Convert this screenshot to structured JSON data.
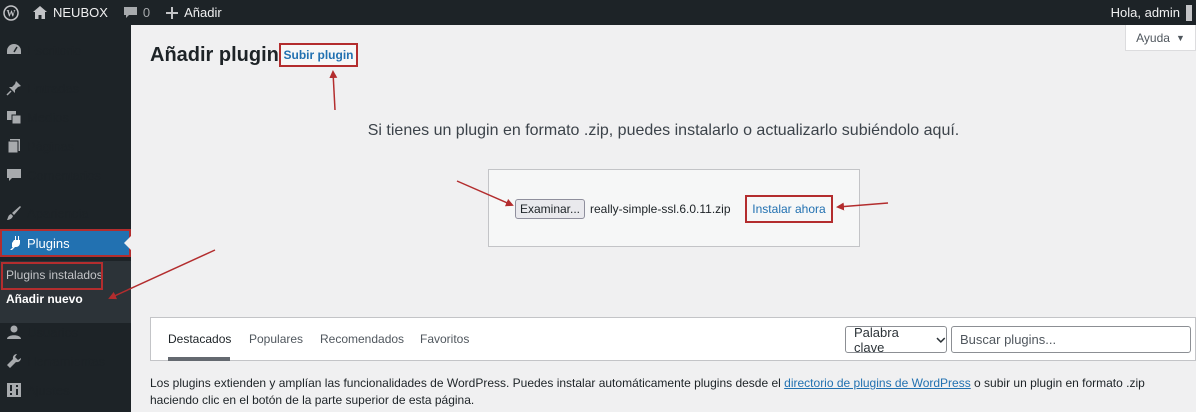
{
  "admin_bar": {
    "site_name": "NEUBOX",
    "comments_count": "0",
    "new_label": "Añadir",
    "greeting": "Hola, admin"
  },
  "sidebar": {
    "items": [
      {
        "label": "Escritorio",
        "icon": "dashboard-icon"
      },
      {
        "label": "Entradas",
        "icon": "pin-icon"
      },
      {
        "label": "Medios",
        "icon": "media-icon"
      },
      {
        "label": "Páginas",
        "icon": "pages-icon"
      },
      {
        "label": "Comentarios",
        "icon": "comments-icon"
      },
      {
        "label": "Apariencia",
        "icon": "appearance-icon"
      },
      {
        "label": "Plugins",
        "icon": "plugins-icon",
        "active": true
      },
      {
        "label": "Usuarios",
        "icon": "users-icon"
      },
      {
        "label": "Herramientas",
        "icon": "tools-icon"
      },
      {
        "label": "Ajustes",
        "icon": "settings-icon"
      }
    ],
    "submenu": [
      {
        "label": "Plugins instalados"
      },
      {
        "label": "Añadir nuevo",
        "current": true
      }
    ]
  },
  "header": {
    "title": "Añadir plugins",
    "upload_label": "Subir plugin",
    "help_label": "Ayuda"
  },
  "upload": {
    "intro": "Si tienes un plugin en formato .zip, puedes instalarlo o actualizarlo subiéndolo aquí.",
    "browse_label": "Examinar...",
    "file_name": "really-simple-ssl.6.0.11.zip",
    "install_label": "Instalar ahora"
  },
  "filter": {
    "tabs": [
      "Destacados",
      "Populares",
      "Recomendados",
      "Favoritos"
    ],
    "current_tab": "Destacados",
    "search_type": "Palabra clave",
    "search_placeholder": "Buscar plugins..."
  },
  "description": {
    "before_link": "Los plugins extienden y amplían las funcionalidades de WordPress. Puedes instalar automáticamente plugins desde el ",
    "link_text": "directorio de plugins de WordPress",
    "after_link": " o subir un plugin en formato .zip haciendo clic en el botón de la parte superior de esta página."
  },
  "colors": {
    "admin_dark": "#1d2327",
    "accent_blue": "#2271b1",
    "annotation_red": "#b32d2e"
  }
}
